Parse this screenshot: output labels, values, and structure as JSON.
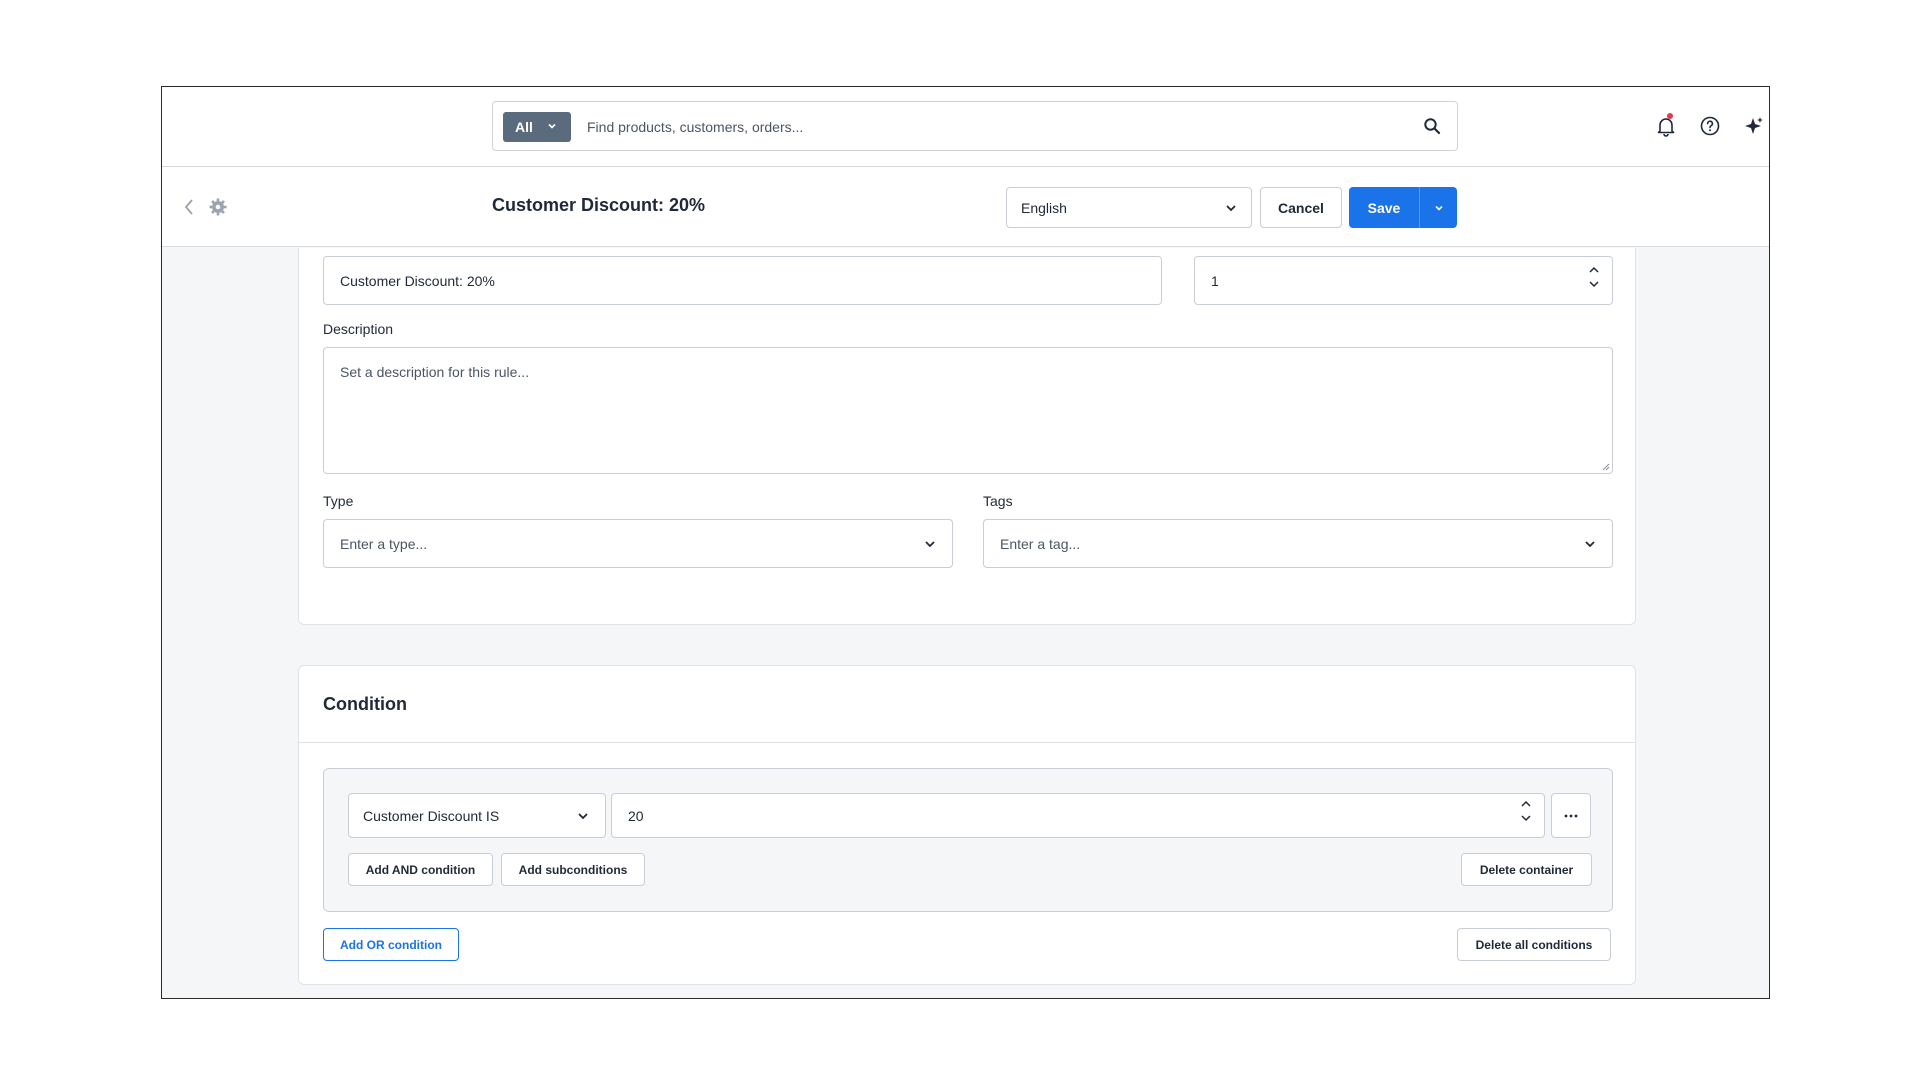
{
  "topbar": {
    "search_scope": "All",
    "search_placeholder": "Find products, customers, orders...",
    "icons": [
      "bell-icon",
      "help-icon",
      "sparkle-icon"
    ]
  },
  "header": {
    "title": "Customer Discount: 20%",
    "language": "English",
    "cancel_label": "Cancel",
    "save_label": "Save"
  },
  "form": {
    "name_value": "Customer Discount: 20%",
    "priority_value": "1",
    "description_label": "Description",
    "description_placeholder": "Set a description for this rule...",
    "type_label": "Type",
    "type_placeholder": "Enter a type...",
    "tags_label": "Tags",
    "tags_placeholder": "Enter a tag..."
  },
  "condition": {
    "title": "Condition",
    "field_value": "Customer Discount IS",
    "value": "20",
    "add_and_label": "Add AND condition",
    "add_sub_label": "Add subconditions",
    "delete_container_label": "Delete container",
    "add_or_label": "Add OR condition",
    "delete_all_label": "Delete all conditions"
  },
  "colors": {
    "primary": "#1a73e8",
    "scope_bg": "#5b6b7e",
    "notification_dot": "#e5384a"
  }
}
